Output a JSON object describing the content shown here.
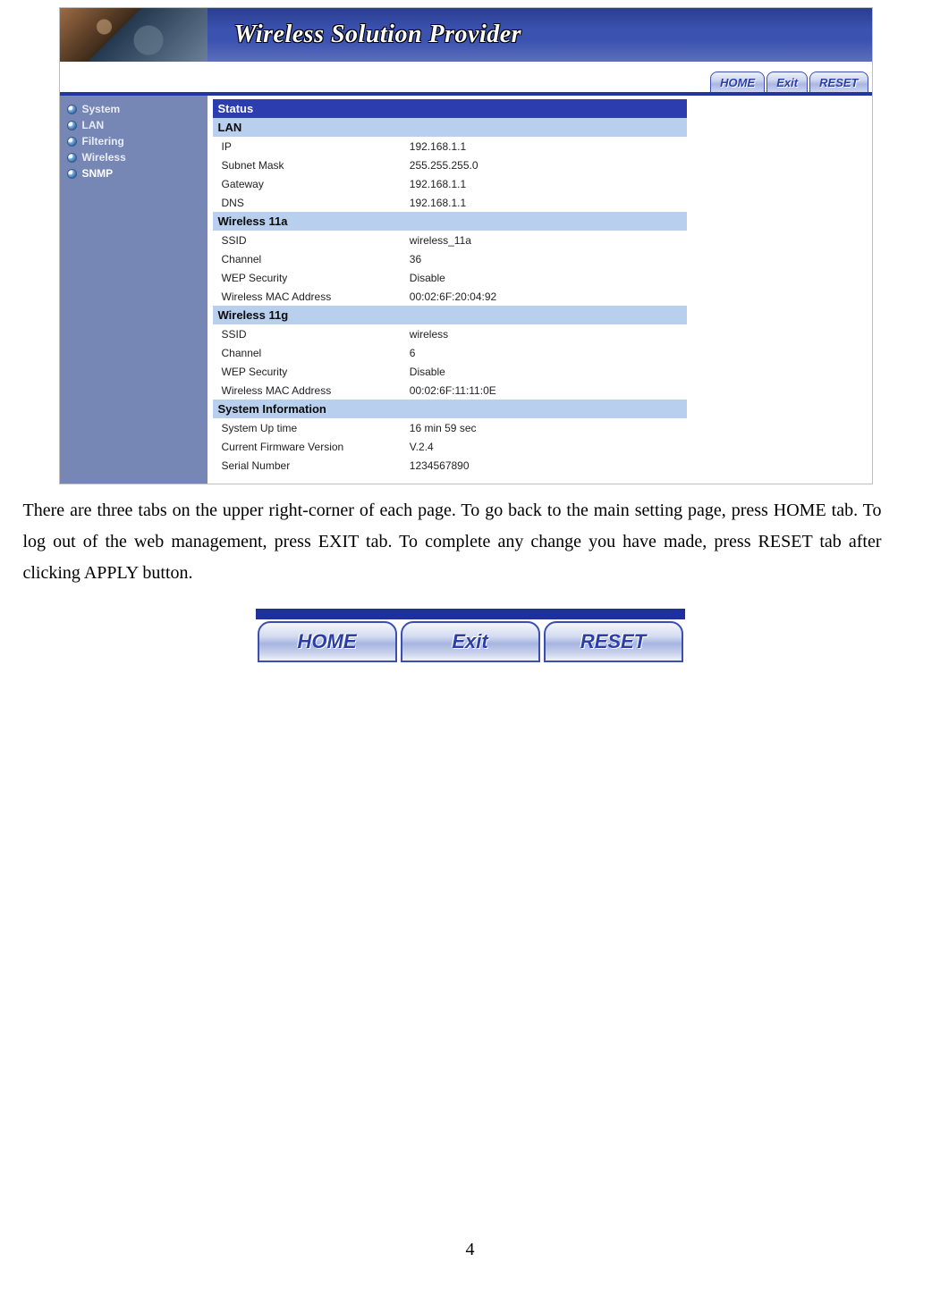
{
  "banner_title": "Wireless Solution Provider",
  "top_tabs": {
    "home": "HOME",
    "exit": "Exit",
    "reset": "RESET"
  },
  "sidebar": {
    "items": [
      {
        "label": "System"
      },
      {
        "label": "LAN"
      },
      {
        "label": "Filtering"
      },
      {
        "label": "Wireless"
      },
      {
        "label": "SNMP"
      }
    ]
  },
  "status": {
    "title": "Status",
    "sections": [
      {
        "header": "LAN",
        "rows": [
          {
            "label": "IP",
            "value": "192.168.1.1"
          },
          {
            "label": "Subnet Mask",
            "value": "255.255.255.0"
          },
          {
            "label": "Gateway",
            "value": "192.168.1.1"
          },
          {
            "label": "DNS",
            "value": "192.168.1.1"
          }
        ]
      },
      {
        "header": "Wireless 11a",
        "rows": [
          {
            "label": "SSID",
            "value": "wireless_11a"
          },
          {
            "label": "Channel",
            "value": "36"
          },
          {
            "label": "WEP Security",
            "value": "Disable"
          },
          {
            "label": "Wireless MAC Address",
            "value": "00:02:6F:20:04:92"
          }
        ]
      },
      {
        "header": "Wireless 11g",
        "rows": [
          {
            "label": "SSID",
            "value": "wireless"
          },
          {
            "label": "Channel",
            "value": "6"
          },
          {
            "label": "WEP Security",
            "value": "Disable"
          },
          {
            "label": "Wireless MAC Address",
            "value": "00:02:6F:11:11:0E"
          }
        ]
      },
      {
        "header": "System Information",
        "rows": [
          {
            "label": "System Up time",
            "value": "16 min 59 sec"
          },
          {
            "label": "Current Firmware Version",
            "value": "V.2.4"
          },
          {
            "label": "Serial Number",
            "value": "1234567890"
          }
        ]
      }
    ]
  },
  "body_paragraph": "There are three tabs on the upper right-corner of each page. To go back to the main setting page, press HOME tab. To log out of the web management, press EXIT tab. To complete any change you have made, press RESET tab after clicking APPLY button.",
  "big_tabs": {
    "home": "HOME",
    "exit": "Exit",
    "reset": "RESET"
  },
  "page_number": "4"
}
